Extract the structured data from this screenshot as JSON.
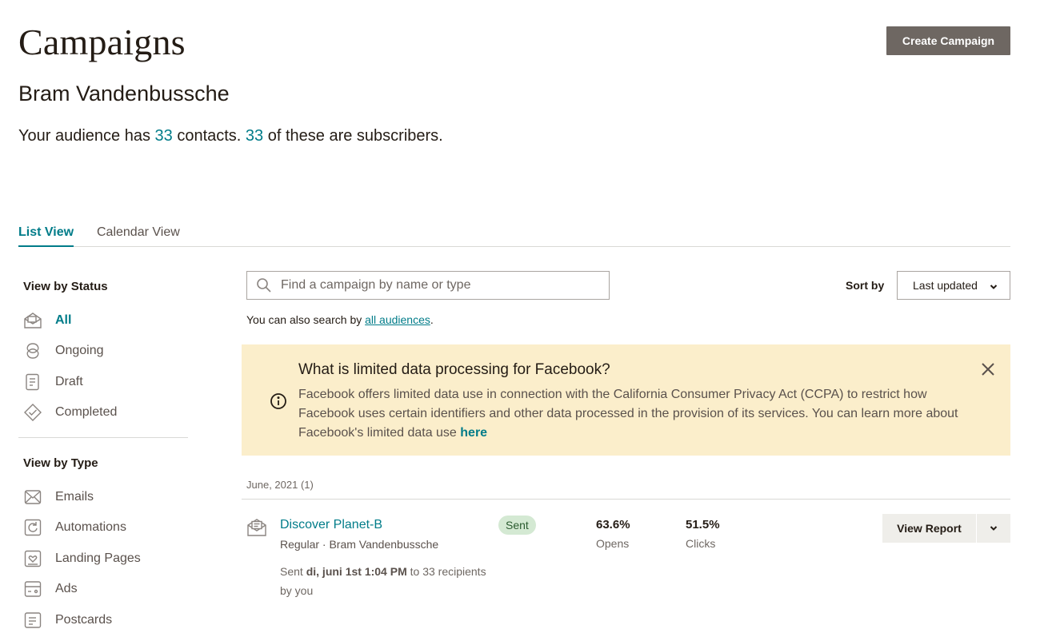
{
  "header": {
    "title": "Campaigns",
    "create_button": "Create Campaign",
    "audience_name": "Bram Vandenbussche",
    "audience_prefix": "Your audience has ",
    "contacts_count": "33",
    "audience_mid": " contacts. ",
    "subscribers_count": "33",
    "audience_suffix": " of these are subscribers."
  },
  "tabs": [
    {
      "label": "List View",
      "active": true
    },
    {
      "label": "Calendar View",
      "active": false
    }
  ],
  "sidebar": {
    "status_heading": "View by Status",
    "status_items": [
      {
        "label": "All",
        "icon": "all-campaigns-icon",
        "active": true
      },
      {
        "label": "Ongoing",
        "icon": "ongoing-icon"
      },
      {
        "label": "Draft",
        "icon": "draft-icon"
      },
      {
        "label": "Completed",
        "icon": "completed-icon"
      }
    ],
    "type_heading": "View by Type",
    "type_items": [
      {
        "label": "Emails",
        "icon": "email-icon"
      },
      {
        "label": "Automations",
        "icon": "automation-icon"
      },
      {
        "label": "Landing Pages",
        "icon": "landing-page-icon"
      },
      {
        "label": "Ads",
        "icon": "ads-icon"
      },
      {
        "label": "Postcards",
        "icon": "postcard-icon"
      }
    ]
  },
  "search": {
    "placeholder": "Find a campaign by name or type",
    "hint_prefix": "You can also search by ",
    "hint_link": "all audiences",
    "hint_suffix": "."
  },
  "sort": {
    "label": "Sort by",
    "value": "Last updated"
  },
  "banner": {
    "title": "What is limited data processing for Facebook?",
    "body": "Facebook offers limited data use in connection with the California Consumer Privacy Act (CCPA) to restrict how Facebook uses certain identifiers and other data processed in the provision of its services. You can learn more about Facebook's limited data use ",
    "link": "here"
  },
  "campaign_group": {
    "label": "June, 2021 (1)",
    "campaigns": [
      {
        "name": "Discover Planet-B",
        "meta": "Regular · Bram Vandenbussche",
        "status": "Sent",
        "sent_prefix": "Sent ",
        "sent_date": "di, juni 1st 1:04 PM",
        "sent_suffix": " to 33 recipients",
        "sent_by": "by you",
        "opens_value": "63.6%",
        "opens_label": "Opens",
        "clicks_value": "51.5%",
        "clicks_label": "Clicks",
        "report_button": "View Report"
      }
    ]
  },
  "colors": {
    "accent": "#007c89",
    "primary_button": "#6e6762",
    "banner_bg": "#fbeecb",
    "sent_badge": "#d4e9d3"
  }
}
